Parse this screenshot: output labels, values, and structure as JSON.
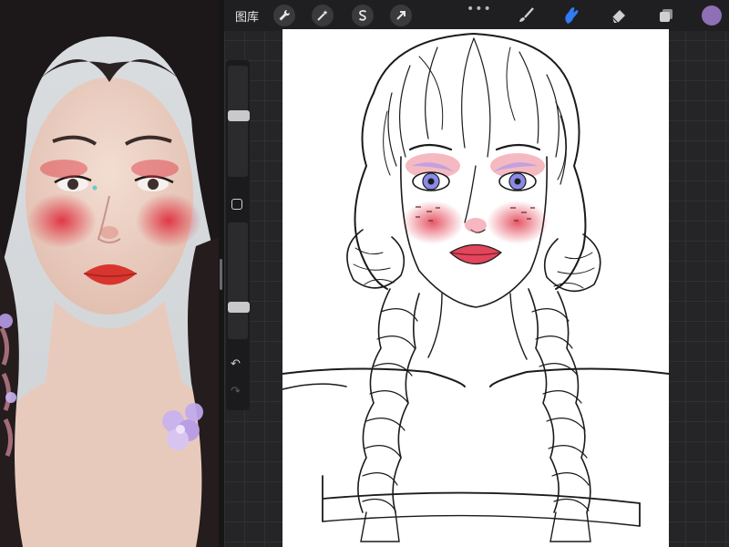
{
  "toolbar": {
    "gallery_label": "图库",
    "more_label": "•••",
    "actions_icon": "wrench-icon",
    "adjustments_icon": "magic-wand-icon",
    "selection_icon": "selection-s-icon",
    "transform_icon": "arrow-cursor-icon",
    "brush_icon": "brush-icon",
    "smudge_icon": "smudge-finger-icon",
    "eraser_icon": "eraser-icon",
    "layers_icon": "layers-icon",
    "active_tool": "smudge",
    "current_color": "#8f6fb5",
    "accent_color": "#2f7cf6"
  },
  "sidebar": {
    "brush_size_level": 0.55,
    "opacity_level": 0.25,
    "undo_icon": "undo-icon",
    "redo_icon": "redo-icon",
    "modify_icon": "square-modify-icon"
  },
  "colors": {
    "workspace_bg": "#252527",
    "canvas_bg": "#ffffff",
    "blush": "#e23a4d",
    "lip": "#e2455c",
    "iris": "#8a8ae8",
    "eyeshadow": "#b59be6"
  }
}
